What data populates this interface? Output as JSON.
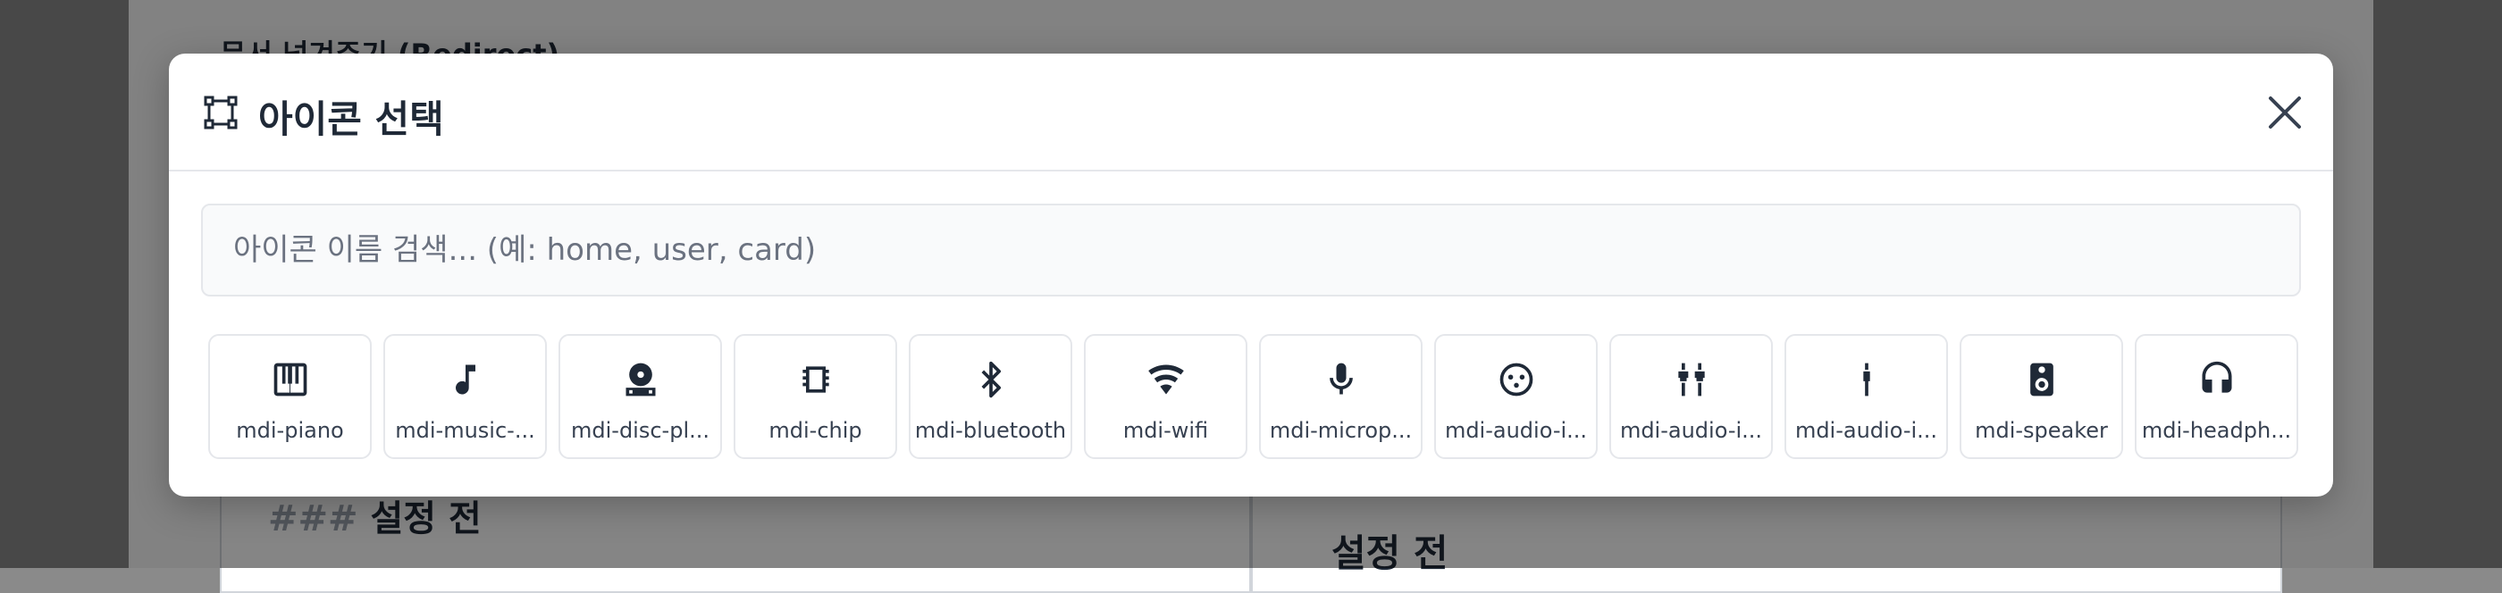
{
  "background": {
    "section_title": "문서 넘겨주기 (Redirect)",
    "editor_line_hash": "###",
    "editor_line_text": "설정 전",
    "preview_heading": "설정 전"
  },
  "modal": {
    "title": "아이콘 선택",
    "header_icon": "vector-square-icon",
    "close_icon": "close-icon",
    "search": {
      "placeholder": "아이콘 이름 검색... (예: home, user, card)",
      "value": ""
    },
    "icons": [
      {
        "name": "piano-icon",
        "label": "mdi-piano"
      },
      {
        "name": "music-note-icon",
        "label": "mdi-music-..."
      },
      {
        "name": "disc-player-icon",
        "label": "mdi-disc-pl..."
      },
      {
        "name": "chip-icon",
        "label": "mdi-chip"
      },
      {
        "name": "bluetooth-icon",
        "label": "mdi-bluetooth"
      },
      {
        "name": "wifi-icon",
        "label": "mdi-wifi"
      },
      {
        "name": "microphone-icon",
        "label": "mdi-microp..."
      },
      {
        "name": "audio-input-xlr-icon",
        "label": "mdi-audio-i..."
      },
      {
        "name": "audio-input-rca-icon",
        "label": "mdi-audio-i..."
      },
      {
        "name": "audio-input-stereo-minijack-icon",
        "label": "mdi-audio-i..."
      },
      {
        "name": "speaker-icon",
        "label": "mdi-speaker"
      },
      {
        "name": "headphones-icon",
        "label": "mdi-headph..."
      }
    ]
  },
  "colors": {
    "overlay": "#000000",
    "tile_border": "#e5e7eb",
    "icon": "#1f2937"
  }
}
